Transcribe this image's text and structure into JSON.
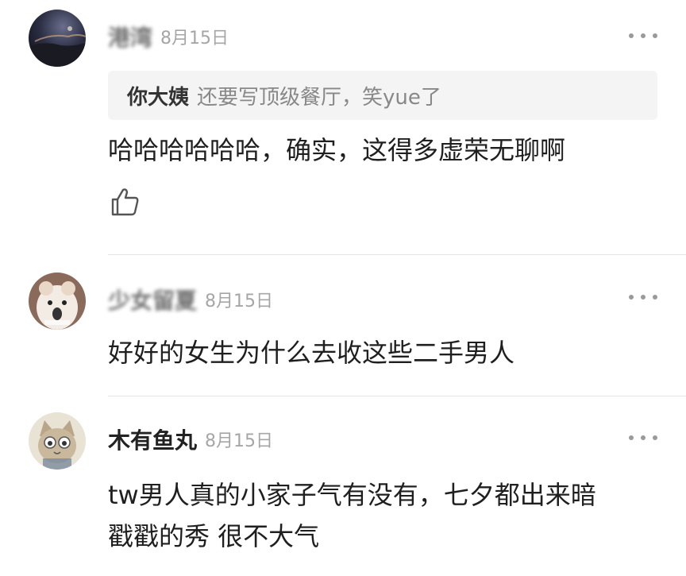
{
  "comments": [
    {
      "username": "港湾",
      "date": "8月15日",
      "quote": {
        "author": "你大姨",
        "text": "还要写顶级餐厅，笑yue了"
      },
      "text": "哈哈哈哈哈哈，确实，这得多虚荣无聊啊",
      "avatar_icon": "night-sky-avatar"
    },
    {
      "username": "少女留夏",
      "date": "8月15日",
      "text": "好好的女生为什么去收这些二手男人",
      "avatar_icon": "cartoon-hamster-avatar"
    },
    {
      "username": "木有鱼丸",
      "date": "8月15日",
      "text_lines": [
        "tw男人真的小家子气有没有，七夕都出来暗",
        "戳戳的秀 很不大气"
      ],
      "avatar_icon": "cartoon-cat-avatar"
    }
  ],
  "icons": {
    "more": "more-dots-icon",
    "like": "thumbs-up-icon"
  },
  "colors": {
    "date": "#a6a6a6",
    "quote_bg": "#f4f4f4",
    "divider": "#e5e5e5"
  }
}
